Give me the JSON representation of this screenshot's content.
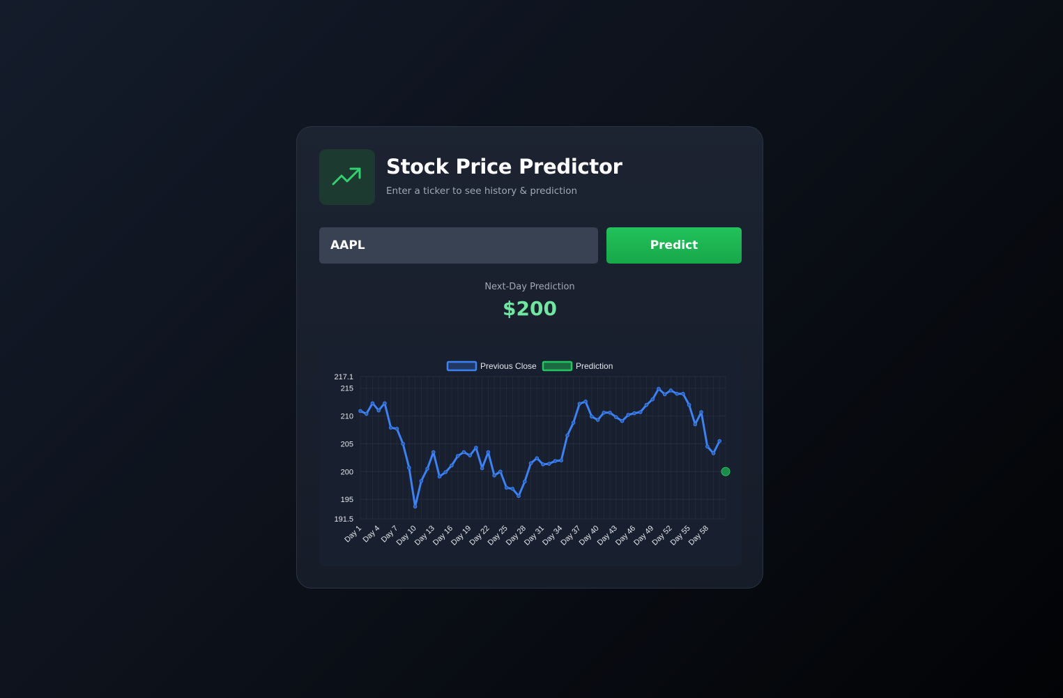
{
  "app": {
    "title": "Stock Price Predictor",
    "subtitle": "Enter a ticker to see history & prediction"
  },
  "form": {
    "ticker_value": "AAPL",
    "predict_label": "Predict"
  },
  "result": {
    "label": "Next-Day Prediction",
    "value": "$200"
  },
  "icons": {
    "logo": "trending-up-icon"
  },
  "colors": {
    "accent_green": "#22c55e",
    "prediction_text": "#6ee7a0",
    "series_blue": "#3b82f6"
  },
  "chart_data": {
    "type": "line",
    "legend": [
      "Previous Close",
      "Prediction"
    ],
    "legend_position": "top",
    "grid": true,
    "ylim": [
      191.5,
      217.1
    ],
    "y_ticks": [
      191.5,
      195,
      200,
      205,
      210,
      215,
      217.1
    ],
    "x_tick_labels": [
      "Day 1",
      "Day 4",
      "Day 7",
      "Day 10",
      "Day 13",
      "Day 16",
      "Day 19",
      "Day 22",
      "Day 25",
      "Day 28",
      "Day 31",
      "Day 34",
      "Day 37",
      "Day 40",
      "Day 43",
      "Day 46",
      "Day 49",
      "Day 52",
      "Day 55",
      "Day 58"
    ],
    "series": [
      {
        "name": "Previous Close",
        "color": "#3b82f6",
        "values": [
          210.9,
          210.4,
          212.3,
          211.0,
          212.3,
          207.9,
          207.7,
          205.0,
          200.7,
          193.7,
          198.3,
          200.5,
          203.5,
          199.1,
          199.9,
          201.1,
          202.8,
          203.5,
          202.9,
          204.3,
          200.6,
          203.5,
          199.3,
          200.0,
          197.1,
          196.9,
          195.6,
          198.2,
          201.5,
          202.4,
          201.3,
          201.4,
          201.9,
          202.0,
          206.5,
          208.8,
          212.2,
          212.6,
          209.9,
          209.3,
          210.6,
          210.6,
          209.8,
          209.1,
          210.2,
          210.5,
          210.7,
          212.0,
          213.0,
          214.9,
          213.9,
          214.6,
          214.0,
          214.0,
          212.0,
          208.5,
          210.7,
          204.5,
          203.3,
          205.5
        ]
      },
      {
        "name": "Prediction",
        "color": "#22c55e",
        "points": [
          {
            "x": 60,
            "y": 200
          }
        ]
      }
    ]
  }
}
